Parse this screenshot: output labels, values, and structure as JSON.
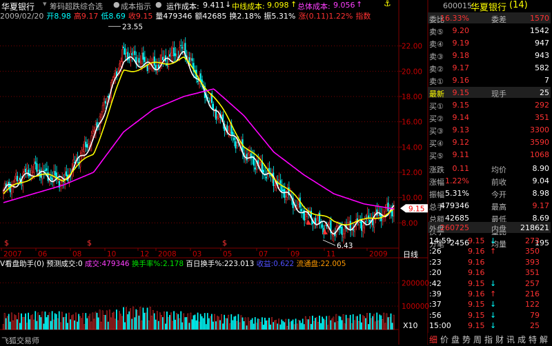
{
  "header": {
    "stock_name": "华夏银行",
    "indicator_name": "筹码超跌综合选",
    "cost_indicator": "成本指示",
    "op_cost_label": "运作成本:",
    "op_cost_value": "9.411",
    "mid_cost_label": "中线成本:",
    "mid_cost_value": "9.098",
    "total_cost_label": "总体成本:",
    "total_cost_value": "9.056"
  },
  "ohlc": {
    "date": "2009/02/20",
    "open": "开8.98",
    "high": "高9.17",
    "low": "低8.69",
    "close": "收9.15",
    "volume": "量479346",
    "amount": "额42685",
    "turnover": "换2.18%",
    "amplitude": "振5.31%",
    "change": "涨(0.11)1.22%",
    "index_btn": "指数"
  },
  "price_axis": [
    "22.00",
    "20.00",
    "18.00",
    "16.00",
    "14.00",
    "12.00",
    "10.00",
    "8.00"
  ],
  "price_annotations": {
    "high": "23.55",
    "low": "6.43",
    "current": "9.15"
  },
  "x_axis": [
    "2007",
    "06",
    "08",
    "10",
    "12",
    "2008",
    "03",
    "05",
    "07",
    "09",
    "11",
    "2009"
  ],
  "x_axis_end": "日线",
  "volume_bar": {
    "title": "V看盘助手(0)",
    "forecast": "预测成交:0",
    "volume": "成交:479346",
    "turnover_rate": "换手率%:2.178",
    "hundred_turnover": "百日换手%:223.013",
    "profit": "收益:0.622",
    "float": "流通盘:22.005"
  },
  "volume_axis": [
    "200000",
    "100000"
  ],
  "volume_unit": "X10",
  "bottom_left_label": "飞狐交易师",
  "side": {
    "code": "600015",
    "name": "华夏银行",
    "count": "(14)",
    "weibi_label": "委比",
    "weibi_value": "16.33%",
    "weicha_label": "委差",
    "weicha_value": "1570",
    "sell": [
      {
        "label": "卖⑤",
        "price": "9.20",
        "vol": "1542"
      },
      {
        "label": "卖④",
        "price": "9.19",
        "vol": "947"
      },
      {
        "label": "卖③",
        "price": "9.18",
        "vol": "943"
      },
      {
        "label": "卖②",
        "price": "9.17",
        "vol": "582"
      },
      {
        "label": "卖①",
        "price": "9.16",
        "vol": "7"
      }
    ],
    "latest_label": "最新",
    "latest_price": "9.15",
    "current_hand_label": "现手",
    "current_hand": "25",
    "buy": [
      {
        "label": "买①",
        "price": "9.15",
        "vol": "292"
      },
      {
        "label": "买②",
        "price": "9.14",
        "vol": "351"
      },
      {
        "label": "买③",
        "price": "9.13",
        "vol": "3300"
      },
      {
        "label": "买④",
        "price": "9.12",
        "vol": "3590"
      },
      {
        "label": "买⑤",
        "price": "9.11",
        "vol": "1068"
      }
    ],
    "stats": [
      {
        "l1": "涨跌",
        "v1": "0.11",
        "l2": "均价",
        "v2": "8.90"
      },
      {
        "l1": "涨幅",
        "v1": "1.22%",
        "l2": "前收",
        "v2": "9.04"
      },
      {
        "l1": "振幅",
        "v1": "5.31%",
        "l2": "今开",
        "v2": "8.98"
      },
      {
        "l1": "总手",
        "v1": "479346",
        "l2": "最高",
        "v2": "9.17"
      },
      {
        "l1": "总额",
        "v1": "42685",
        "l2": "最低",
        "v2": "8.69"
      },
      {
        "l1": "换手",
        "v1": "2.18%",
        "l2": "量比",
        "v2": "1.05"
      },
      {
        "l1": "分笔",
        "v1": "2456",
        "l2": "均量",
        "v2": "195"
      }
    ],
    "outer_label": "外盘",
    "outer_value": "260725",
    "inner_label": "内盘",
    "inner_value": "218621",
    "ticks": [
      {
        "time": "14:59",
        "price": "9.15",
        "vol": "273",
        "dir": "↓"
      },
      {
        "time": ":26",
        "price": "9.16",
        "vol": "350",
        "dir": "↑"
      },
      {
        "time": ":23",
        "price": "9.16",
        "vol": "393",
        "dir": ""
      },
      {
        "time": ":20",
        "price": "9.16",
        "vol": "351",
        "dir": ""
      },
      {
        "time": ":42",
        "price": "9.15",
        "vol": "257",
        "dir": "↓"
      },
      {
        "time": ":39",
        "price": "9.16",
        "vol": "216",
        "dir": "↑"
      },
      {
        "time": ":37",
        "price": "9.15",
        "vol": "122",
        "dir": "↓"
      },
      {
        "time": ":56",
        "price": "9.15",
        "vol": "79",
        "dir": "↓"
      },
      {
        "time": "15:00",
        "price": "9.15",
        "vol": "25",
        "dir": "↓"
      }
    ],
    "bottom_tabs": [
      "细",
      "价",
      "盘",
      "势",
      "周",
      "指",
      "财",
      "讯",
      "成",
      "特",
      "解"
    ]
  },
  "colors": {
    "up": "#ff3232",
    "down": "#00ffff",
    "ma_white": "#ffffff",
    "ma_yellow": "#ffff00",
    "ma_magenta": "#ff00ff",
    "grid": "#800000"
  },
  "chart_data": {
    "type": "candlestick",
    "ylim": [
      6.0,
      24.0
    ],
    "x": [
      "2007-01",
      "2007-03",
      "2007-06",
      "2007-08",
      "2007-10",
      "2007-12",
      "2008-01",
      "2008-03",
      "2008-05",
      "2008-07",
      "2008-09",
      "2008-11",
      "2009-01",
      "2009-02"
    ],
    "close": [
      10.6,
      12.3,
      11.2,
      15.0,
      21.5,
      20.4,
      21.8,
      17.0,
      13.6,
      11.4,
      8.8,
      7.3,
      8.0,
      9.15
    ],
    "series": [
      {
        "values": [
          10.5,
          12.0,
          11.3,
          14.5,
          21.0,
          20.3,
          21.3,
          17.0,
          13.6,
          11.4,
          8.7,
          7.4,
          8.0,
          9.1
        ]
      },
      {
        "values": [
          10.3,
          11.8,
          11.5,
          13.5,
          20.0,
          20.5,
          21.0,
          18.0,
          14.2,
          11.7,
          9.3,
          8.0,
          8.1,
          9.0
        ]
      },
      {
        "values": [
          9.6,
          10.3,
          11.0,
          12.0,
          15.2,
          17.0,
          18.0,
          18.6,
          16.5,
          13.6,
          11.8,
          10.3,
          9.5,
          9.1
        ]
      }
    ],
    "volume": [
      55000,
      60000,
      55000,
      65000,
      75000,
      60000,
      55000,
      50000,
      40000,
      35000,
      45000,
      50000,
      55000,
      47934
    ]
  }
}
